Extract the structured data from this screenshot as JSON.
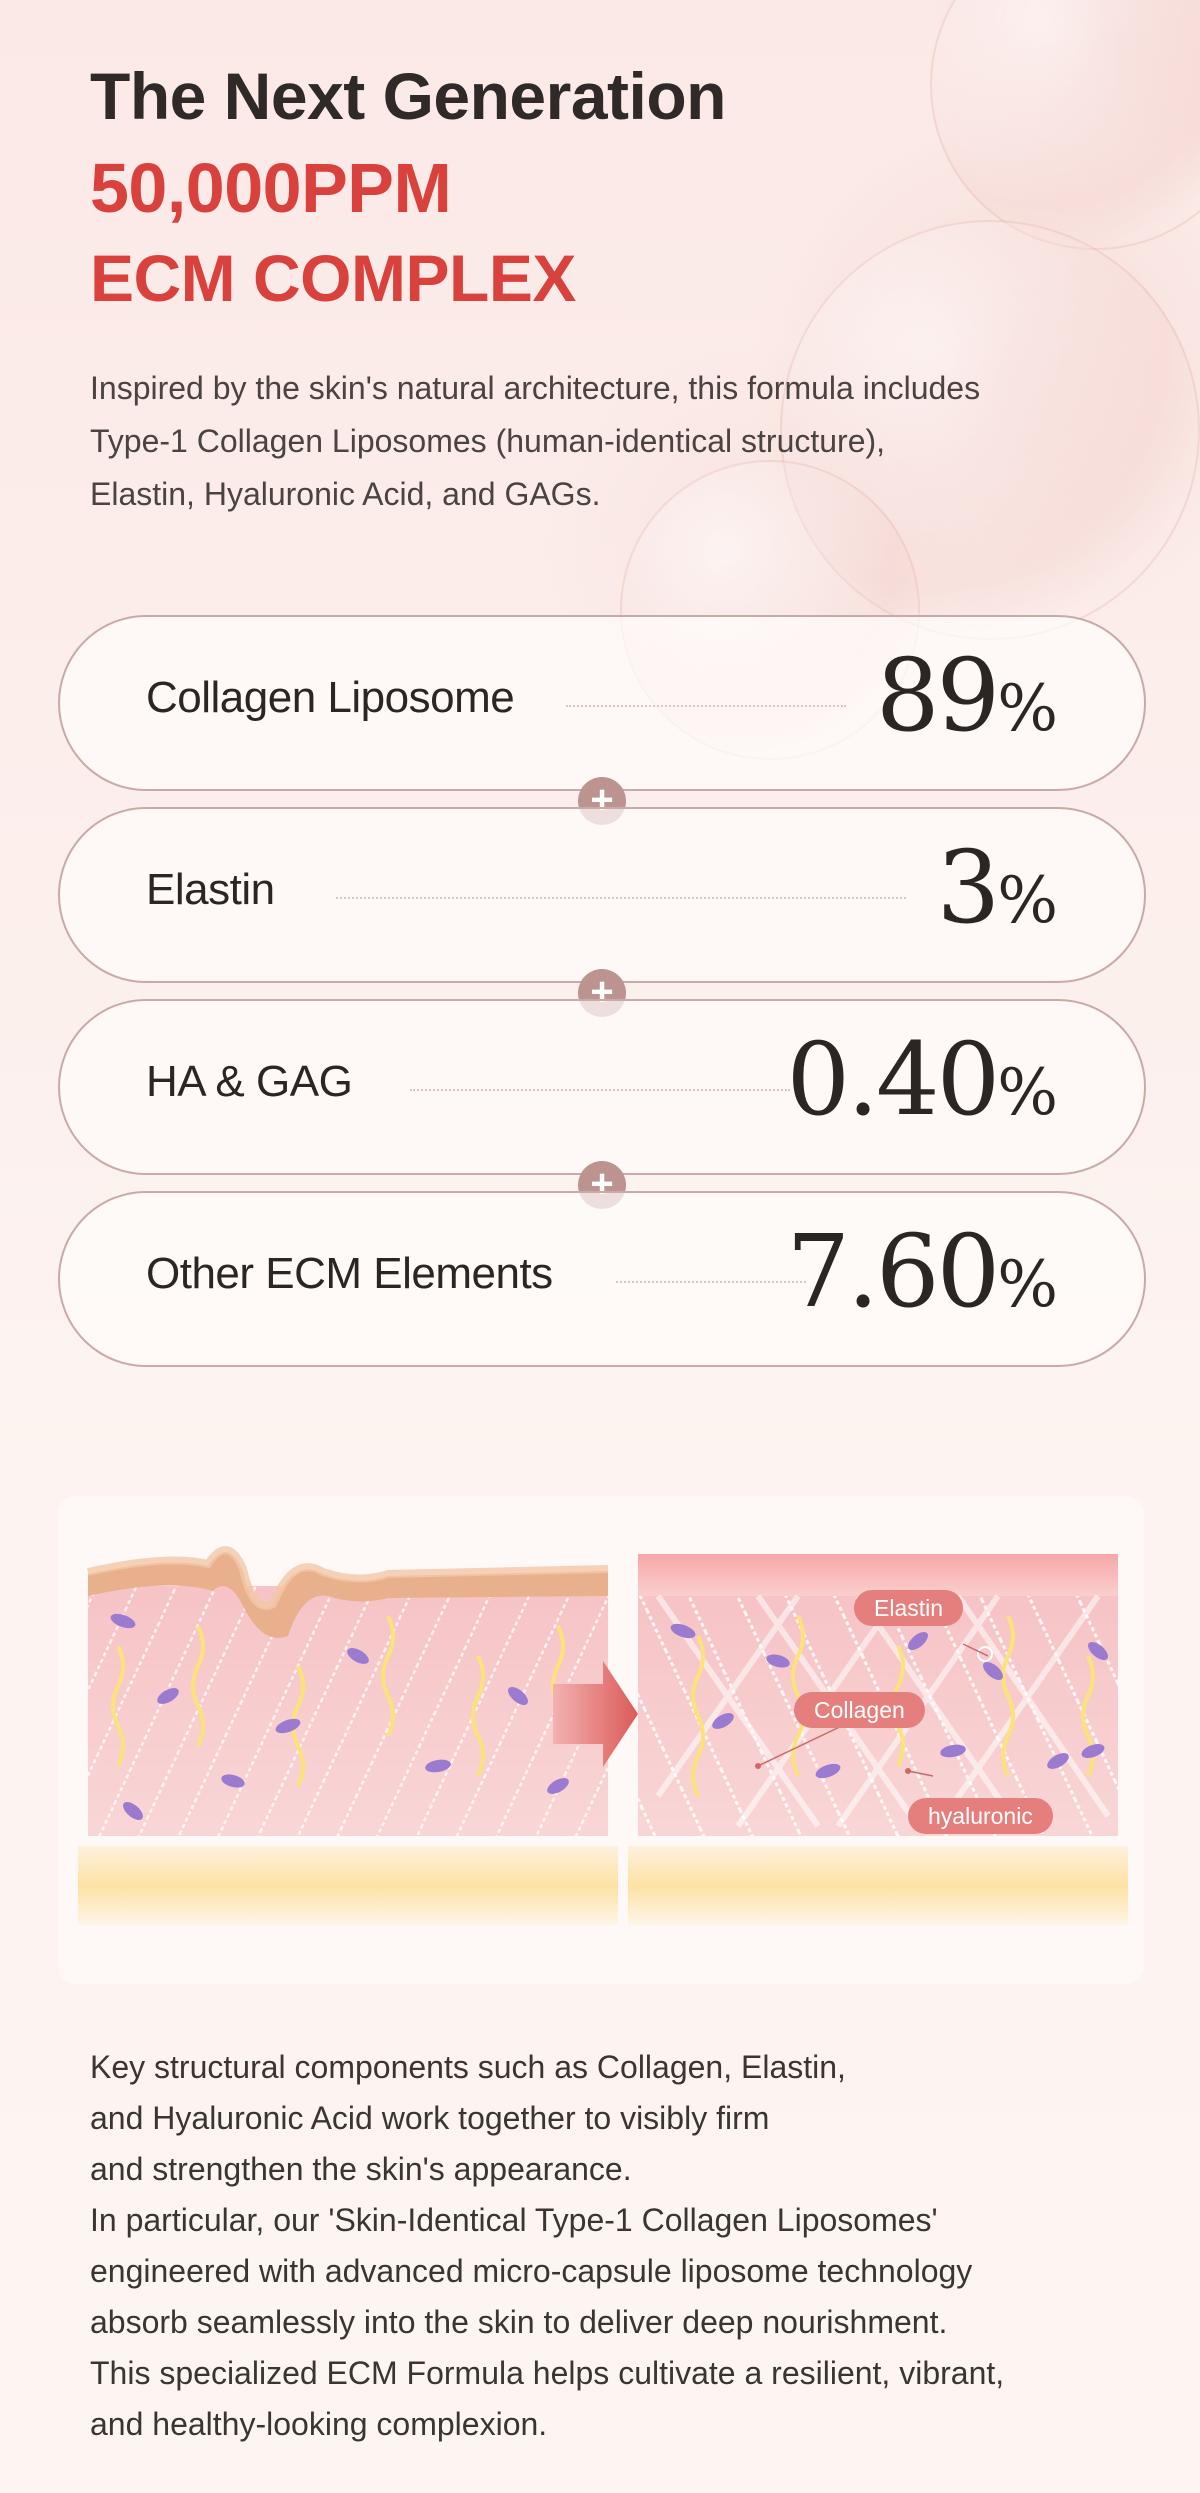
{
  "header": {
    "line1": "The Next Generation",
    "line2": "50,000PPM",
    "line3": "ECM COMPLEX"
  },
  "intro": [
    "Inspired by the skin's natural architecture, this formula includes",
    "Type-1 Collagen Liposomes (human-identical structure),",
    "Elastin, Hyaluronic Acid, and GAGs."
  ],
  "ingredients": [
    {
      "label": "Collagen Liposome",
      "value": "89",
      "unit": "%"
    },
    {
      "label": "Elastin",
      "value": "3",
      "unit": "%"
    },
    {
      "label": "HA & GAG",
      "value": "0.40",
      "unit": "%"
    },
    {
      "label": "Other ECM Elements",
      "value": "7.60",
      "unit": "%"
    }
  ],
  "plus_symbol": "+",
  "illustration": {
    "tags": {
      "elastin": "Elastin",
      "collagen": "Collagen",
      "hyaluronic": "hyaluronic"
    },
    "icons": [
      "skin-before-icon",
      "arrow-right-icon",
      "skin-after-icon"
    ]
  },
  "body": [
    "Key structural components such as Collagen, Elastin,",
    "and Hyaluronic Acid work together to visibly firm",
    "and strengthen the skin's appearance.",
    "In particular, our 'Skin-Identical Type-1 Collagen Liposomes'",
    "engineered with advanced micro-capsule liposome technology",
    "absorb seamlessly into the skin to deliver deep nourishment.",
    "This specialized ECM Formula helps cultivate a resilient, vibrant,",
    "and healthy-looking complexion."
  ],
  "colors": {
    "accent": "#d9413d",
    "pill_border": "#c9aaa6",
    "plus_badge": "#bd9390",
    "tag": "#e57f7d"
  }
}
